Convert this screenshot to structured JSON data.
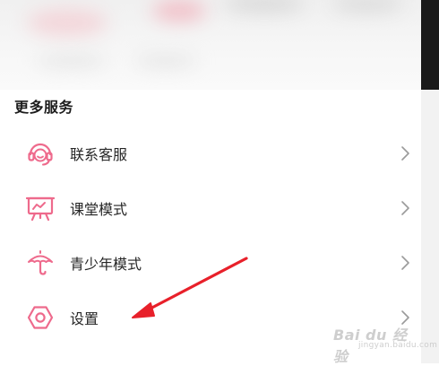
{
  "section": {
    "title": "更多服务"
  },
  "items": [
    {
      "label": "联系客服",
      "icon": "headset-icon"
    },
    {
      "label": "课堂模式",
      "icon": "presentation-board-icon"
    },
    {
      "label": "青少年模式",
      "icon": "umbrella-icon"
    },
    {
      "label": "设置",
      "icon": "hexagon-settings-icon"
    }
  ],
  "watermark": {
    "main": "Bai du 经验",
    "sub": "jingyan.baidu.com"
  },
  "colors": {
    "accent": "#ee6a8c",
    "chevron": "#9a9a9a",
    "annotation_arrow": "#e8202a"
  }
}
